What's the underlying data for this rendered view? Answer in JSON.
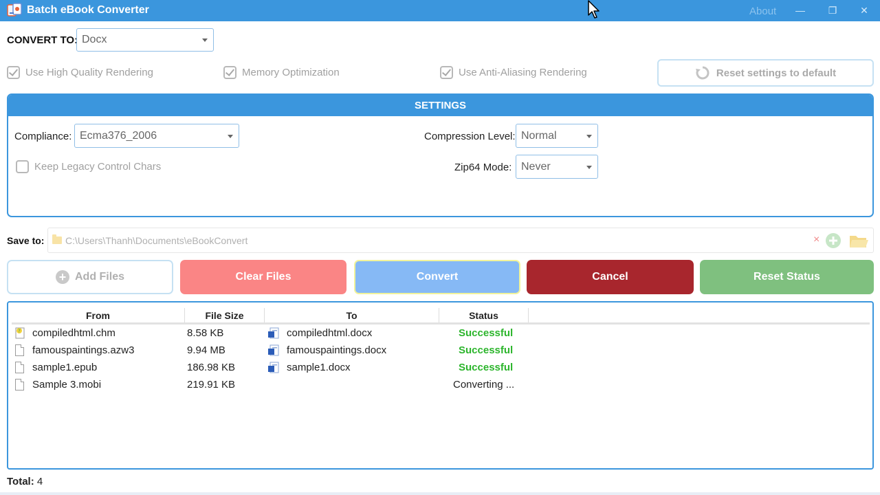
{
  "window": {
    "title": "Batch eBook Converter",
    "about": "About",
    "controls": {
      "minimize": "—",
      "restore": "❐",
      "close": "✕"
    }
  },
  "convert_to": {
    "label": "CONVERT TO:",
    "value": "Docx"
  },
  "options": {
    "high_quality": {
      "label": "Use High Quality Rendering",
      "checked": true
    },
    "memory_opt": {
      "label": "Memory Optimization",
      "checked": true
    },
    "anti_alias": {
      "label": "Use Anti-Aliasing Rendering",
      "checked": true
    },
    "reset_label": "Reset settings to default"
  },
  "settings": {
    "header": "SETTINGS",
    "compliance_label": "Compliance:",
    "compliance_value": "Ecma376_2006",
    "keep_legacy_label": "Keep Legacy Control Chars",
    "compression_label": "Compression Level:",
    "compression_value": "Normal",
    "zip64_label": "Zip64 Mode:",
    "zip64_value": "Never"
  },
  "save_to": {
    "label": "Save to:",
    "path": "C:\\Users\\Thanh\\Documents\\eBookConvert",
    "clear": "×"
  },
  "actions": {
    "add_files": "Add Files",
    "clear_files": "Clear Files",
    "convert": "Convert",
    "cancel": "Cancel",
    "reset_status": "Reset Status"
  },
  "table": {
    "columns": [
      "From",
      "File Size",
      "To",
      "Status"
    ],
    "rows": [
      {
        "from": "compiledhtml.chm",
        "size": "8.58 KB",
        "to": "compiledhtml.docx",
        "status": "Successful"
      },
      {
        "from": "famouspaintings.azw3",
        "size": "9.94 MB",
        "to": "famouspaintings.docx",
        "status": "Successful"
      },
      {
        "from": "sample1.epub",
        "size": "186.98 KB",
        "to": "sample1.docx",
        "status": "Successful"
      },
      {
        "from": "Sample 3.mobi",
        "size": "219.91 KB",
        "to": "",
        "status": "Converting ..."
      }
    ]
  },
  "footer": {
    "total_label": "Total:",
    "total_value": "4"
  },
  "colors": {
    "accent": "#3b96dd",
    "success": "#2cb52c",
    "clear": "#fa8585",
    "convert": "#86b9f5",
    "cancel": "#a8262d",
    "reset": "#7fc07f"
  }
}
